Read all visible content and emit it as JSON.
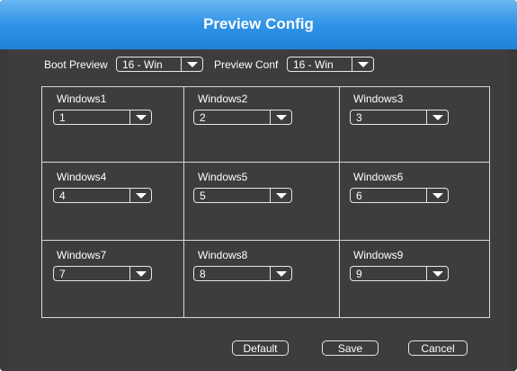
{
  "dialog": {
    "title": "Preview Config"
  },
  "top_row": {
    "boot_preview_label": "Boot Preview",
    "boot_preview_value": "16 - Win",
    "preview_conf_label": "Preview Conf",
    "preview_conf_value": "16 - Win"
  },
  "windows": [
    {
      "label": "Windows1",
      "value": "1"
    },
    {
      "label": "Windows2",
      "value": "2"
    },
    {
      "label": "Windows3",
      "value": "3"
    },
    {
      "label": "Windows4",
      "value": "4"
    },
    {
      "label": "Windows5",
      "value": "5"
    },
    {
      "label": "Windows6",
      "value": "6"
    },
    {
      "label": "Windows7",
      "value": "7"
    },
    {
      "label": "Windows8",
      "value": "8"
    },
    {
      "label": "Windows9",
      "value": "9"
    }
  ],
  "buttons": {
    "default_label": "Default",
    "save_label": "Save",
    "cancel_label": "Cancel"
  },
  "colors": {
    "title_bar": "#2f93e6",
    "background": "#3d3d3d",
    "border": "#e6e6e6"
  },
  "icons": {
    "dropdown": "chevron-down-icon"
  }
}
